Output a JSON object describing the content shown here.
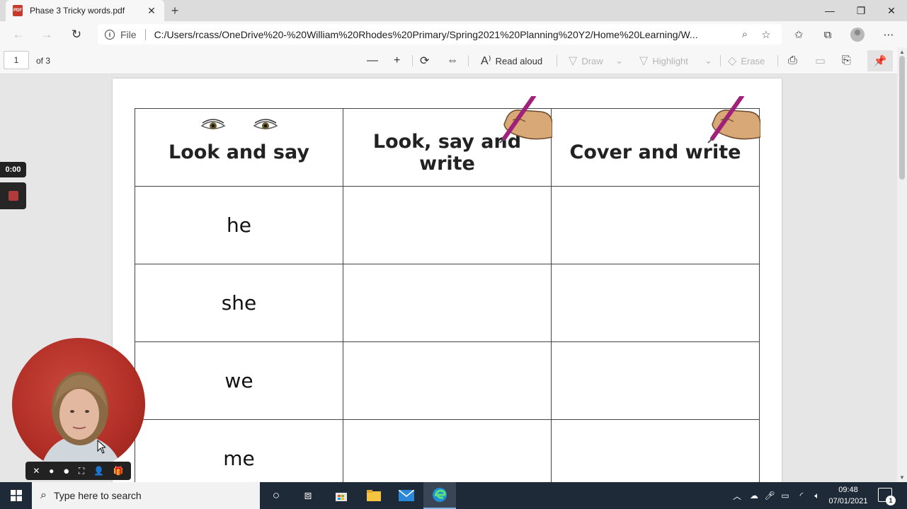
{
  "browser": {
    "tab_title": "Phase 3 Tricky words.pdf",
    "tab_icon_label": "PDF",
    "new_tab": "+",
    "window_controls": {
      "minimize": "—",
      "restore": "❐",
      "close": "✕"
    }
  },
  "address": {
    "file_label": "File",
    "url": "C:/Users/rcass/OneDrive%20-%20William%20Rhodes%20Primary/Spring2021%20Planning%20Y2/Home%20Learning/W..."
  },
  "pdf_toolbar": {
    "page_number": "1",
    "page_of": "of 3",
    "read_aloud": "Read aloud",
    "draw": "Draw",
    "highlight": "Highlight",
    "erase": "Erase"
  },
  "worksheet": {
    "headers": [
      "Look and say",
      "Look, say and write",
      "Cover and write"
    ],
    "words": [
      "he",
      "she",
      "we",
      "me"
    ]
  },
  "recorder": {
    "timer": "0:00"
  },
  "taskbar": {
    "search_placeholder": "Type here to search",
    "time": "09:48",
    "date": "07/01/2021",
    "notifications": "1"
  },
  "colors": {
    "taskbar": "#1f2a38",
    "pen_magenta": "#a0207a",
    "webcam_background": "#b23027"
  }
}
